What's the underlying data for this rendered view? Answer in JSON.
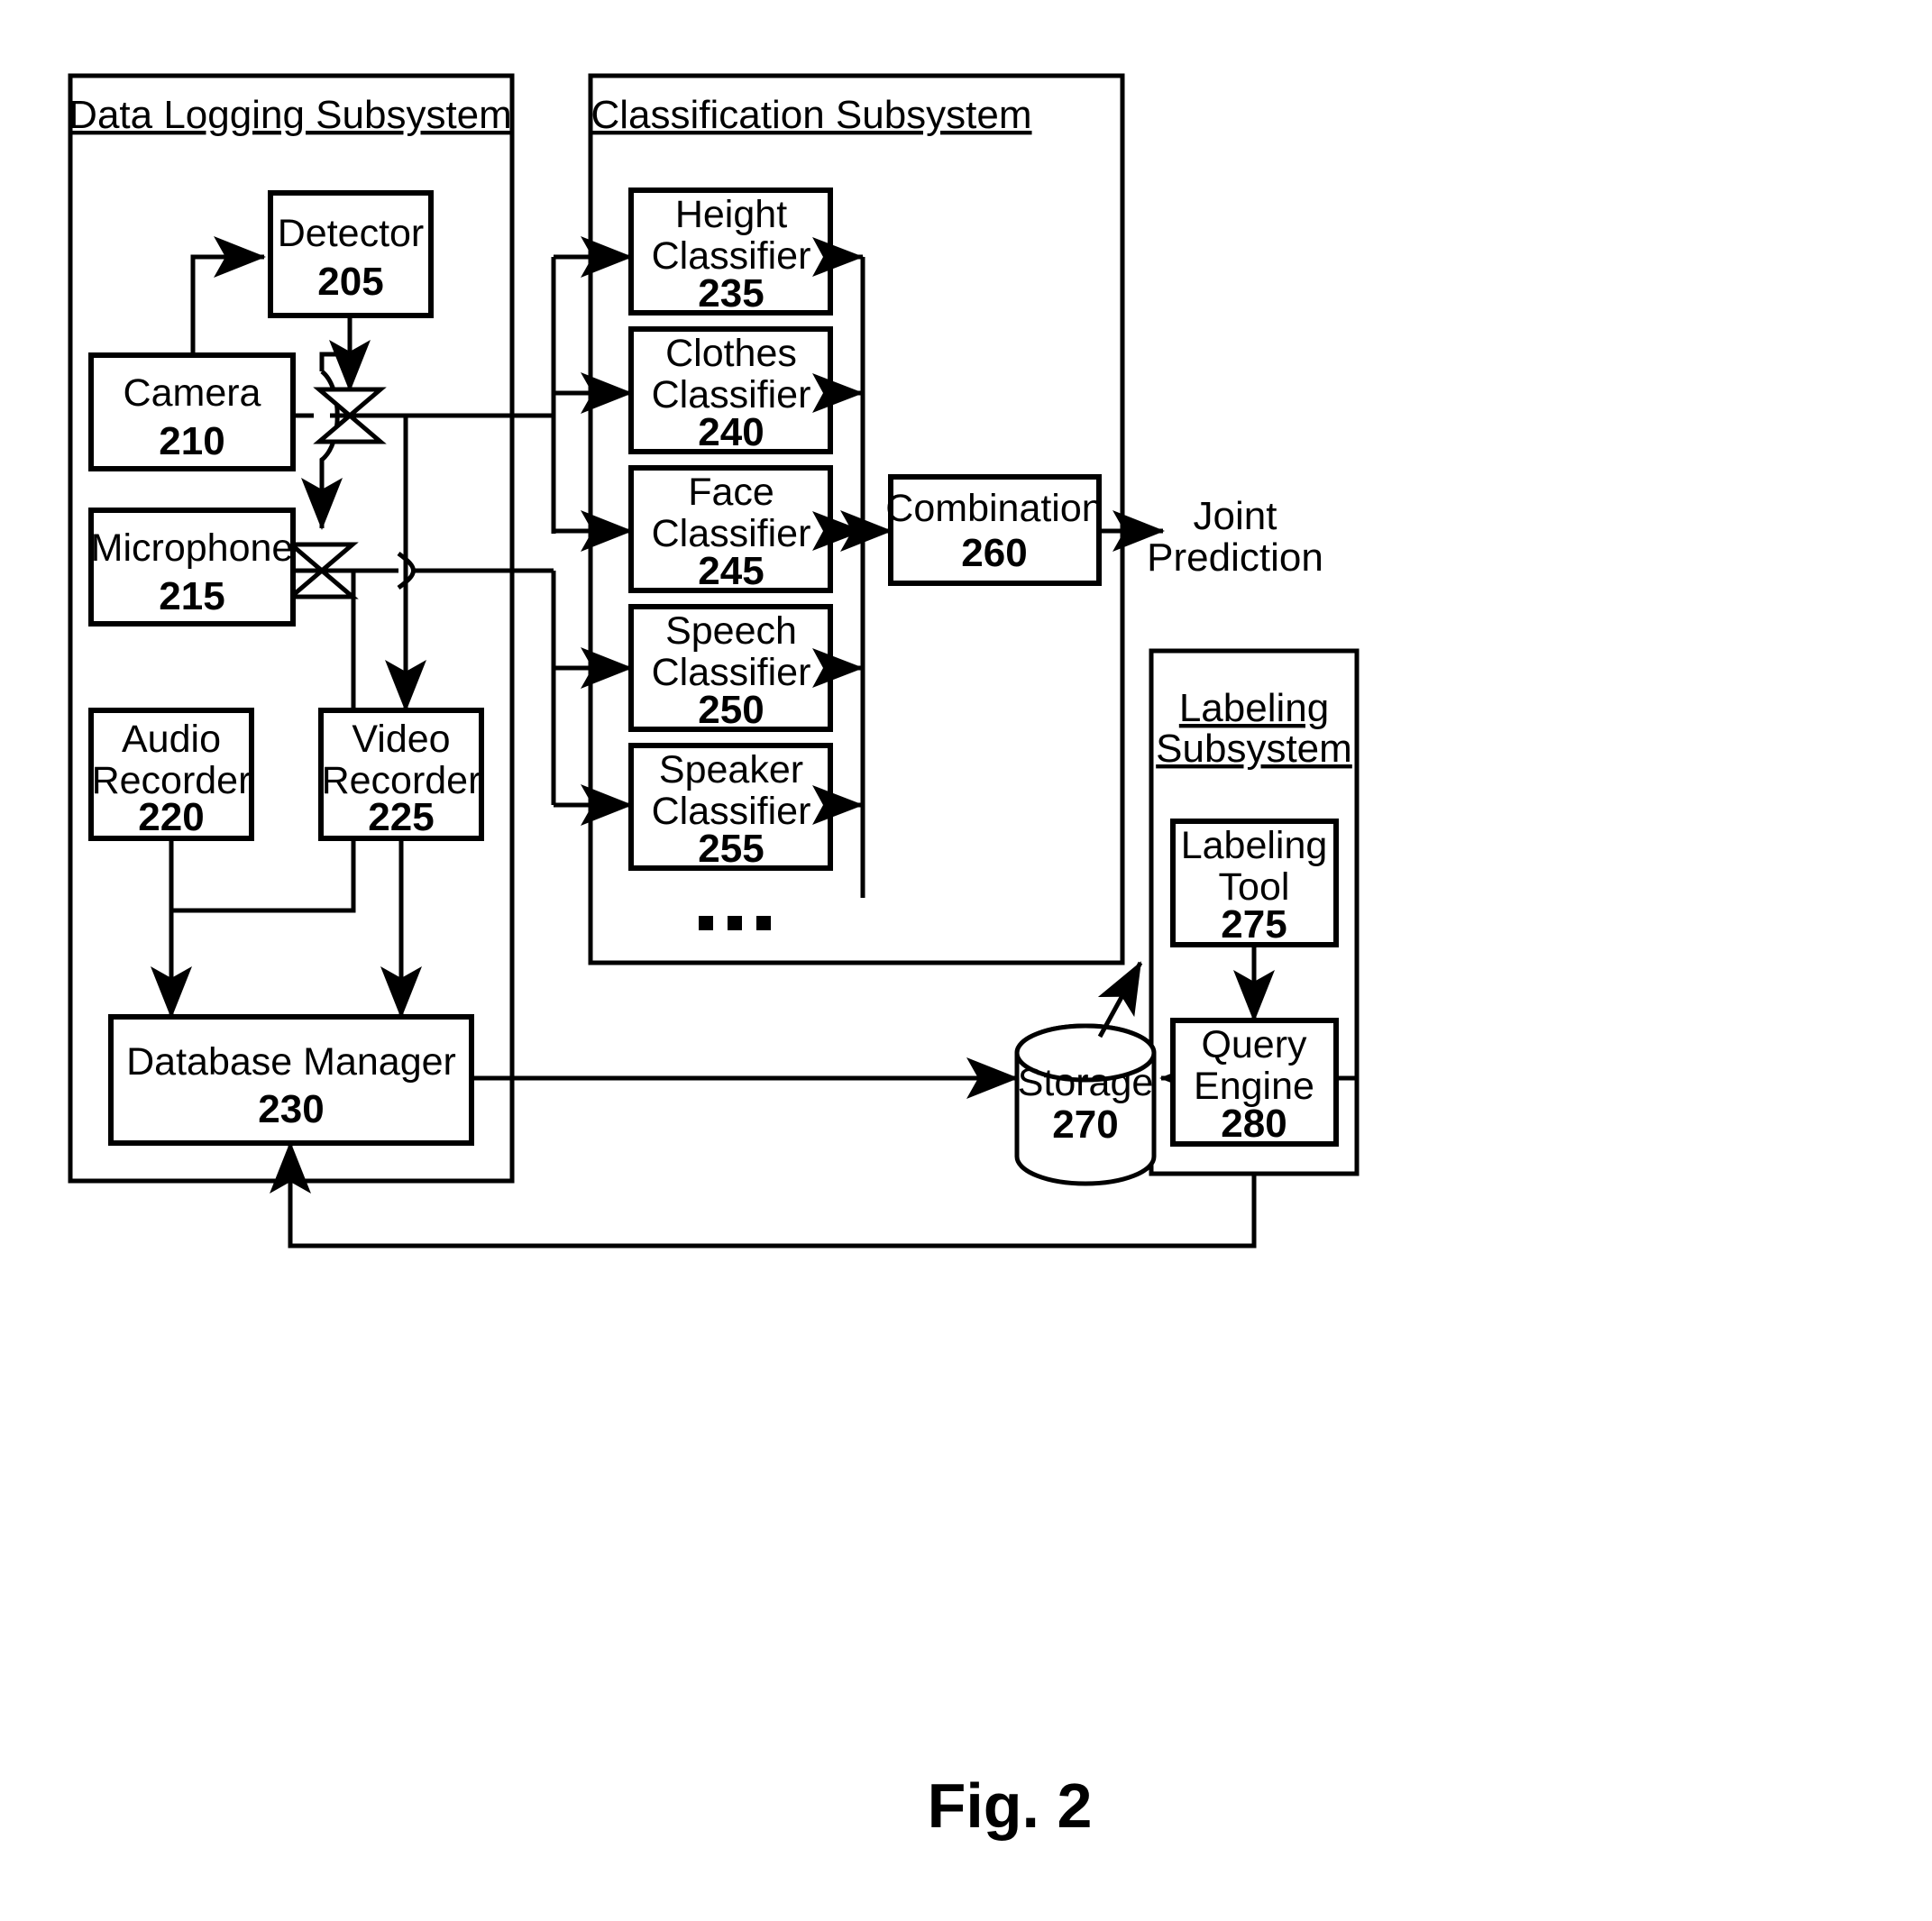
{
  "figure": {
    "caption": "Fig. 2"
  },
  "panels": [
    {
      "id": "data-logging",
      "title": "Data Logging Subsystem"
    },
    {
      "id": "classification",
      "title": "Classification Subsystem"
    },
    {
      "id": "labeling",
      "title_line1": "Labeling",
      "title_line2": "Subsystem"
    }
  ],
  "nodes": {
    "detector": {
      "line1": "Detector",
      "line2": "",
      "num": "205"
    },
    "camera": {
      "line1": "Camera",
      "line2": "",
      "num": "210"
    },
    "microphone": {
      "line1": "Microphone",
      "line2": "",
      "num": "215"
    },
    "audio_recorder": {
      "line1": "Audio",
      "line2": "Recorder",
      "num": "220"
    },
    "video_recorder": {
      "line1": "Video",
      "line2": "Recorder",
      "num": "225"
    },
    "database_manager": {
      "line1": "Database Manager",
      "line2": "",
      "num": "230"
    },
    "height_classifier": {
      "line1": "Height",
      "line2": "Classifier",
      "num": "235"
    },
    "clothes_classifier": {
      "line1": "Clothes",
      "line2": "Classifier",
      "num": "240"
    },
    "face_classifier": {
      "line1": "Face",
      "line2": "Classifier",
      "num": "245"
    },
    "speech_classifier": {
      "line1": "Speech",
      "line2": "Classifier",
      "num": "250"
    },
    "speaker_classifier": {
      "line1": "Speaker",
      "line2": "Classifier",
      "num": "255"
    },
    "combination": {
      "line1": "Combination",
      "line2": "",
      "num": "260"
    },
    "storage": {
      "line1": "Storage",
      "line2": "",
      "num": "270"
    },
    "labeling_tool": {
      "line1": "Labeling",
      "line2": "Tool",
      "num": "275"
    },
    "query_engine": {
      "line1": "Query",
      "line2": "Engine",
      "num": "280"
    }
  },
  "labels": {
    "joint_prediction_line1": "Joint",
    "joint_prediction_line2": "Prediction",
    "ellipsis": "..."
  },
  "colors": {
    "stroke": "#000000",
    "fill": "#ffffff"
  }
}
